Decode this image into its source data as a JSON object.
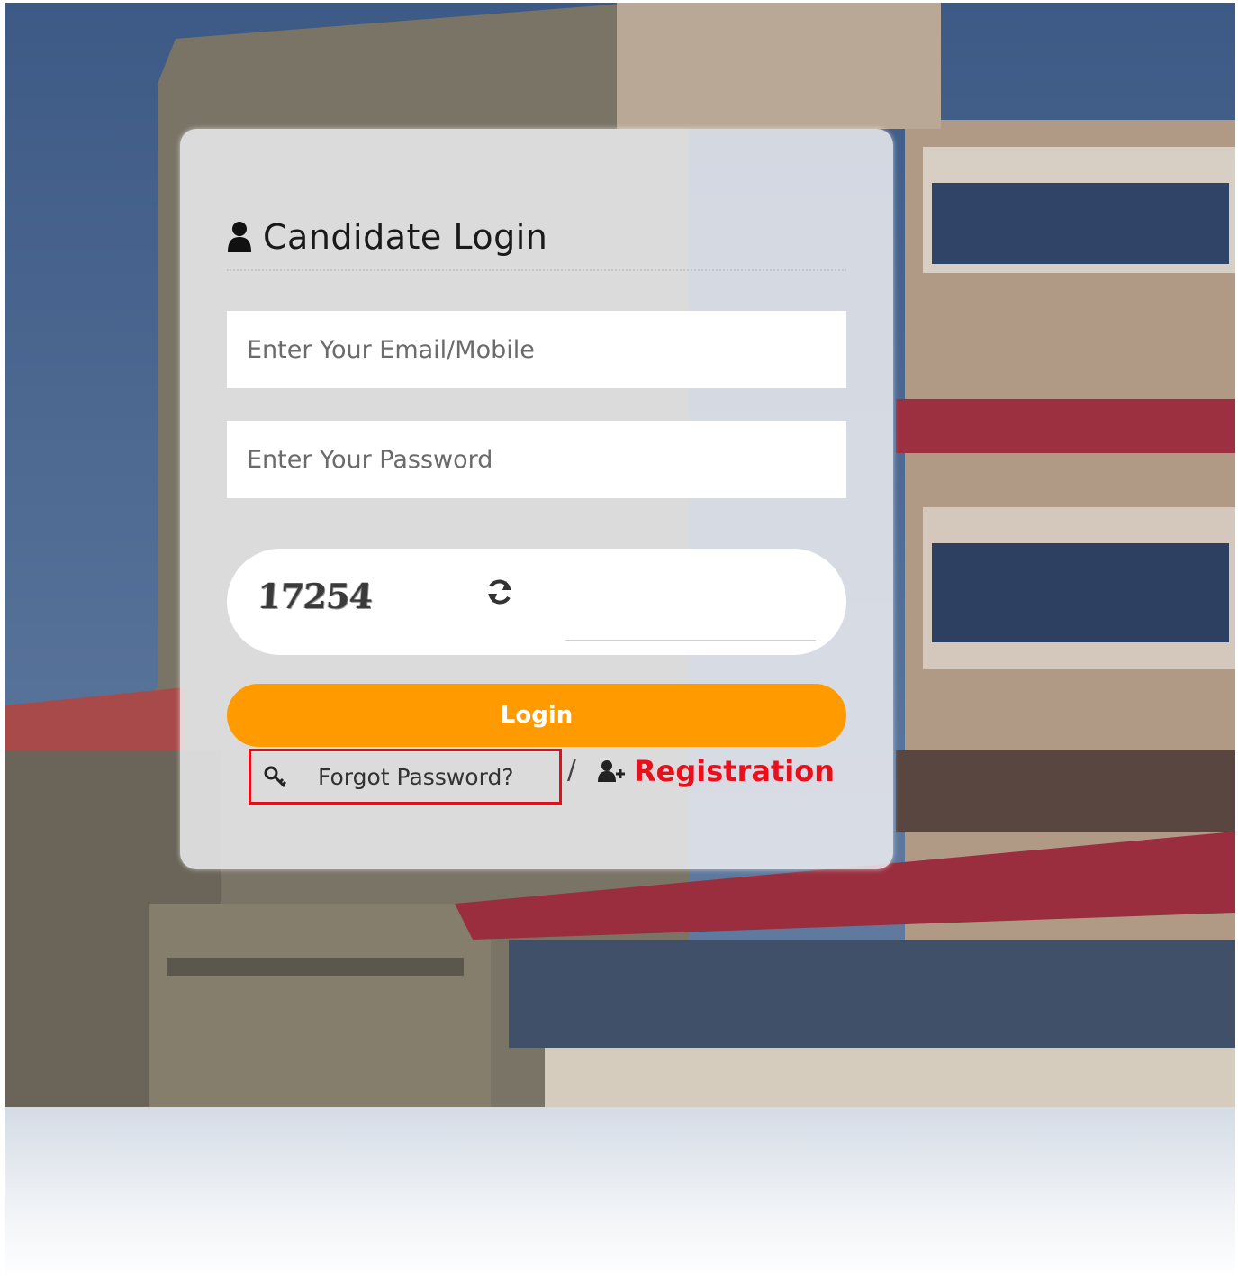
{
  "login": {
    "title": "Candidate Login",
    "email_placeholder": "Enter Your Email/Mobile",
    "password_placeholder": "Enter Your Password",
    "captcha_code": "17254",
    "login_button": "Login",
    "forgot_password_link": "Forgot Password?",
    "separator": "/",
    "registration_link": "Registration"
  },
  "colors": {
    "login_button": "#ff9b00",
    "registration_text": "#e8101c",
    "highlight_border": "#e0101a"
  },
  "icons": {
    "title": "user-icon",
    "captcha_refresh": "refresh-icon",
    "forgot": "key-icon",
    "registration": "user-plus-icon"
  }
}
